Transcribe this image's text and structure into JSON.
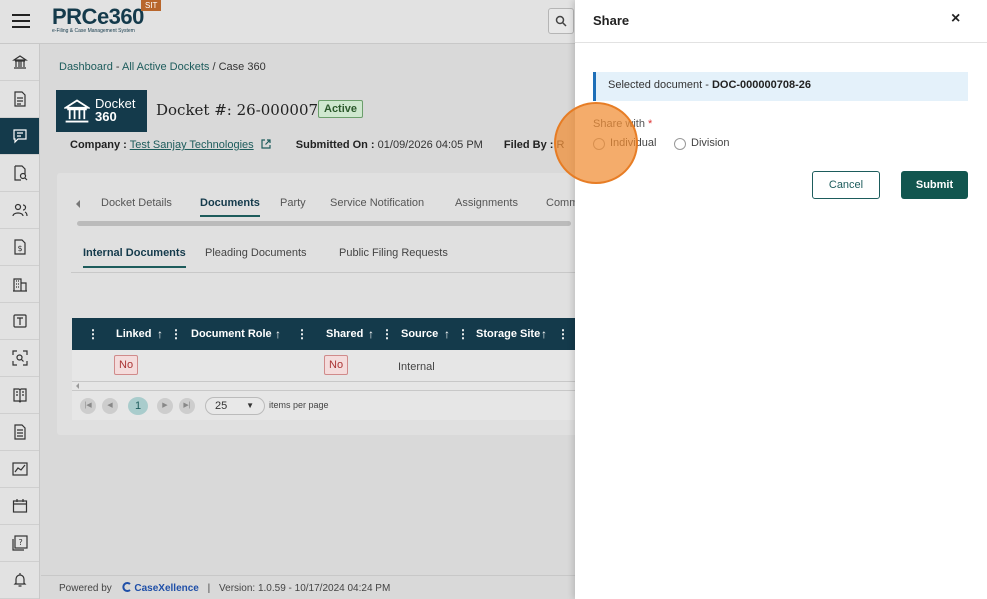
{
  "app": {
    "logo_text": "PRCe360",
    "logo_subtitle": "e-Filing & Case Management System",
    "env_badge": "SIT"
  },
  "sidebar": {
    "items": [
      {
        "icon": "bank-icon"
      },
      {
        "icon": "document-icon"
      },
      {
        "icon": "chat-icon",
        "active": true
      },
      {
        "icon": "file-search-icon"
      },
      {
        "icon": "users-icon"
      },
      {
        "icon": "dollar-doc-icon"
      },
      {
        "icon": "building-icon"
      },
      {
        "icon": "text-box-icon"
      },
      {
        "icon": "scan-icon"
      },
      {
        "icon": "book-icon"
      },
      {
        "icon": "page-icon"
      },
      {
        "icon": "chart-icon"
      },
      {
        "icon": "calendar-icon"
      },
      {
        "icon": "help-icon"
      },
      {
        "icon": "bell-icon"
      }
    ]
  },
  "breadcrumb": {
    "dashboard": "Dashboard",
    "sep1": " - ",
    "active_dockets": "All Active Dockets",
    "sep2": " / ",
    "current": "Case 360"
  },
  "docket": {
    "logo_line1": "Docket",
    "logo_line2": "360",
    "title": "Docket #: 26-0000075",
    "status": "Active"
  },
  "info": {
    "company_label": "Company :",
    "company_value": "Test Sanjay Technologies",
    "submitted_label": "Submitted On :",
    "submitted_value": "01/09/2026 04:05 PM",
    "filed_by_label": "Filed By :",
    "filed_by_value": "R"
  },
  "tabs": [
    "Docket Details",
    "Documents",
    "Party",
    "Service Notification",
    "Assignments",
    "Comm"
  ],
  "active_tab": "Documents",
  "subtabs": [
    "Internal Documents",
    "Pleading Documents",
    "Public Filing Requests"
  ],
  "active_subtab": "Internal Documents",
  "grid": {
    "columns": [
      "Linked",
      "Document Role",
      "Shared",
      "Source",
      "Storage Site"
    ],
    "rows": [
      {
        "linked": "No",
        "document_role": "",
        "shared": "No",
        "source": "Internal",
        "storage_site": ""
      }
    ]
  },
  "pager": {
    "current_page": "1",
    "page_size": "25",
    "items_per_page_label": "items per page"
  },
  "footer": {
    "powered_by": "Powered by",
    "brand": "CaseXellence",
    "sep": "|",
    "version": "Version: 1.0.59 - 10/17/2024 04:24 PM"
  },
  "share_panel": {
    "title": "Share",
    "close": "×",
    "selected_prefix": "Selected document - ",
    "selected_doc": "DOC-000000708-26",
    "share_with_label": "Share with",
    "required_mark": "*",
    "options": [
      "Individual",
      "Division"
    ],
    "cancel_label": "Cancel",
    "submit_label": "Submit"
  },
  "colors": {
    "brand_dark": "#143a4b",
    "accent_teal": "#12564f",
    "info_blue": "#1e6fb8",
    "click_highlight": "#f08c32"
  }
}
